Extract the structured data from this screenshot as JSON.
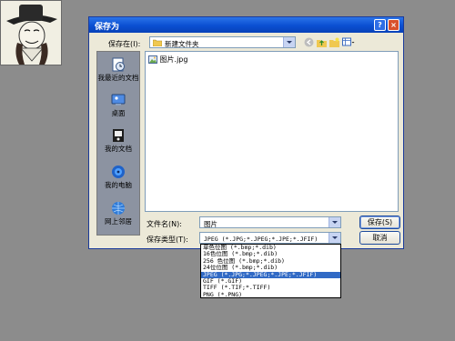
{
  "dialog": {
    "title": "保存为",
    "help": "?",
    "close": "×"
  },
  "toolbar": {
    "save_in_label": "保存在(I):",
    "current_folder": "新建文件夹",
    "icons": [
      "back-icon",
      "up-folder-icon",
      "new-folder-icon",
      "view-menu-icon"
    ]
  },
  "places": [
    {
      "label": "我最近的文档",
      "icon": "recent-documents-icon"
    },
    {
      "label": "桌面",
      "icon": "desktop-icon"
    },
    {
      "label": "我的文档",
      "icon": "my-documents-icon"
    },
    {
      "label": "我的电脑",
      "icon": "my-computer-icon"
    },
    {
      "label": "网上邻居",
      "icon": "network-places-icon"
    }
  ],
  "files": [
    {
      "name": "图片.jpg",
      "icon": "image-file-icon"
    }
  ],
  "form": {
    "filename_label": "文件名(N):",
    "filename_value": "图片",
    "filetype_label": "保存类型(T):",
    "filetype_value": "JPEG (*.JPG;*.JPEG;*.JPE;*.JFIF)"
  },
  "buttons": {
    "save": "保存(S)",
    "cancel": "取消"
  },
  "filetype_options": [
    "单色位图 (*.bmp;*.dib)",
    "16色位图 (*.bmp;*.dib)",
    "256 色位图 (*.bmp;*.dib)",
    "24位位图 (*.bmp;*.dib)",
    "JPEG (*.JPG;*.JPEG;*.JPE;*.JFIF)",
    "GIF (*.GIF)",
    "TIFF (*.TIF;*.TIFF)",
    "PNG (*.PNG)"
  ],
  "selected_filetype_index": 4,
  "colors": {
    "titlebar": "#0a4fd2",
    "selection": "#316ac5",
    "dialog_bg": "#ece9d8",
    "desktop": "#8c8c8c"
  }
}
